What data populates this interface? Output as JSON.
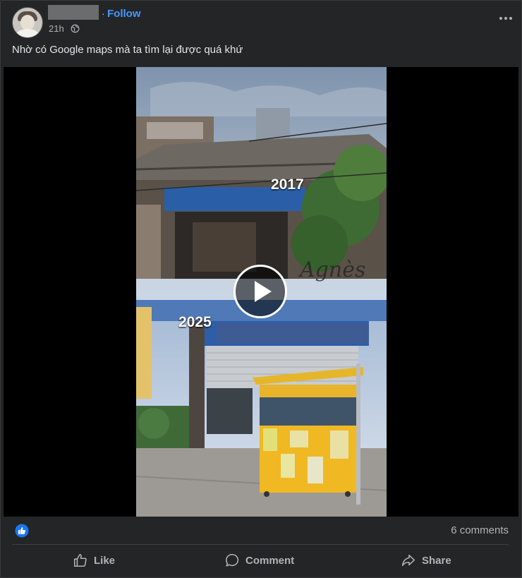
{
  "post": {
    "follow_label": "Follow",
    "separator": "·",
    "timestamp": "21h",
    "caption": "Nhờ có Google maps  mà ta tìm lại được quá khứ"
  },
  "video": {
    "year_top": "2017",
    "year_bottom": "2025",
    "watermark": "Agnès"
  },
  "footer": {
    "comments": "6 comments",
    "like": "Like",
    "comment": "Comment",
    "share": "Share"
  },
  "colors": {
    "accent": "#4599ff",
    "card_bg": "#242526",
    "like_blue": "#1877f2"
  }
}
